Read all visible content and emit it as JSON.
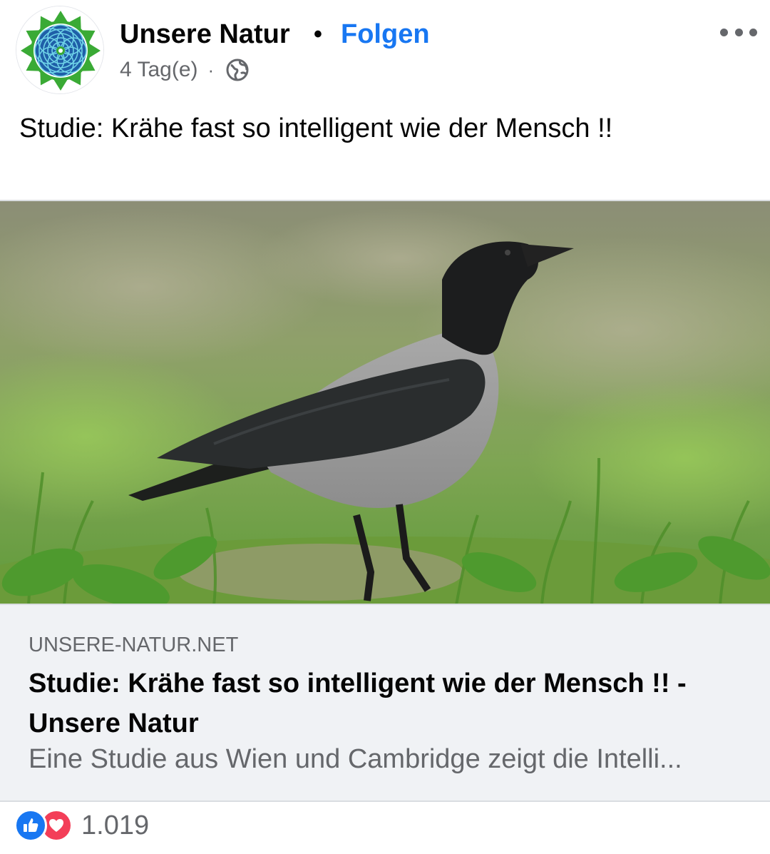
{
  "post": {
    "page_name": "Unsere Natur",
    "separator": "•",
    "follow_label": "Folgen",
    "time": "4 Tag(e)",
    "meta_separator": "·",
    "privacy_icon": "globe-icon",
    "text": "Studie: Krähe fast so intelligent wie der Mensch !!"
  },
  "link_preview": {
    "domain": "UNSERE-NATUR.NET",
    "title": "Studie: Krähe fast so intelligent wie der Mensch !! - Unsere Natur",
    "description": "Eine Studie aus Wien und Cambridge zeigt die Intelli..."
  },
  "reactions": {
    "icons": [
      "like-icon",
      "love-icon"
    ],
    "count": "1.019"
  },
  "colors": {
    "accent": "#1877f2",
    "secondary_text": "#65676b",
    "love": "#f33e58",
    "link_bg": "#f0f2f5"
  }
}
